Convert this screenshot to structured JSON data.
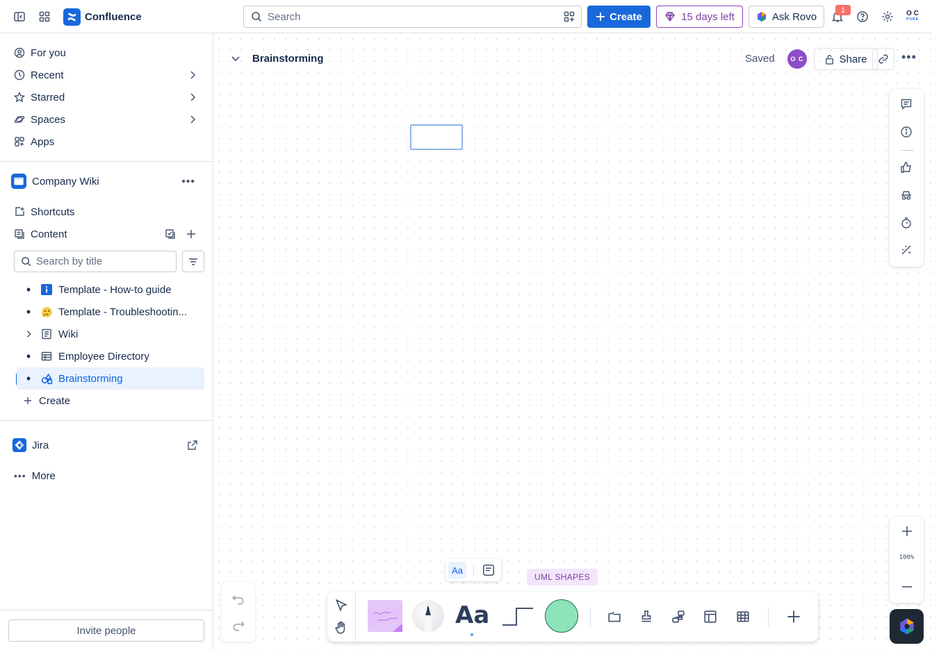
{
  "topbar": {
    "app_name": "Confluence",
    "search_placeholder": "Search",
    "create_label": "Create",
    "trial_label": "15 days left",
    "rovo_label": "Ask Rovo",
    "notification_count": "1",
    "avatar_initials_top": "O C",
    "avatar_initials_bottom": "PURE"
  },
  "sidebar": {
    "nav": [
      {
        "label": "For you"
      },
      {
        "label": "Recent"
      },
      {
        "label": "Starred"
      },
      {
        "label": "Spaces"
      },
      {
        "label": "Apps"
      }
    ],
    "space_name": "Company Wiki",
    "shortcuts_label": "Shortcuts",
    "content_label": "Content",
    "title_search_placeholder": "Search by title",
    "tree": [
      {
        "label": "Template - How-to guide"
      },
      {
        "label": "Template - Troubleshootin..."
      },
      {
        "label": "Wiki"
      },
      {
        "label": "Employee Directory"
      },
      {
        "label": "Brainstorming"
      }
    ],
    "create_label": "Create",
    "jira_label": "Jira",
    "more_label": "More",
    "invite_label": "Invite people"
  },
  "page": {
    "title": "Brainstorming",
    "status": "Saved",
    "avatar_initials": "O C",
    "share_label": "Share"
  },
  "canvas": {
    "zoom": "100%",
    "uml_label": "UML SHAPES",
    "text_tool_small": "Aa",
    "text_tool_big": "Aa"
  },
  "colors": {
    "brand": "#1868db",
    "trial_purple": "#803fa5",
    "sticky": "#e3c6f7",
    "shape_fill": "#8ee3b8",
    "selected_bg": "#e9f2fe"
  }
}
